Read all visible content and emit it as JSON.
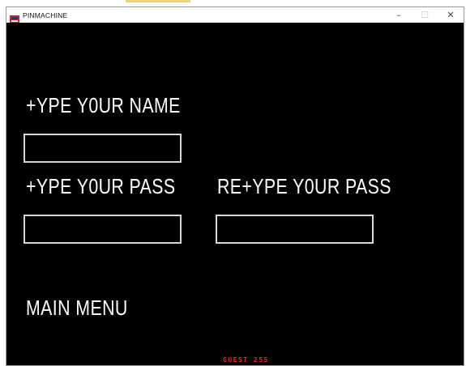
{
  "window": {
    "title": "PINMACHINE",
    "minimize_icon": "minimize-icon",
    "maximize_icon": "maximize-icon",
    "close_icon": "close-icon"
  },
  "form": {
    "name_label": "+YPE Y0UR NAME",
    "name_value": "",
    "pass_label": "+YPE Y0UR PASS",
    "pass_value": "",
    "repass_label": "RE+YPE Y0UR PASS",
    "repass_value": ""
  },
  "menu": {
    "main_menu_label": "MAIN MENU"
  },
  "status": {
    "guest_text": "GUEST 255"
  },
  "colors": {
    "background": "#000000",
    "text": "#ffffff",
    "field_border": "#d8d8d8",
    "status_text": "#ff1e1e"
  }
}
